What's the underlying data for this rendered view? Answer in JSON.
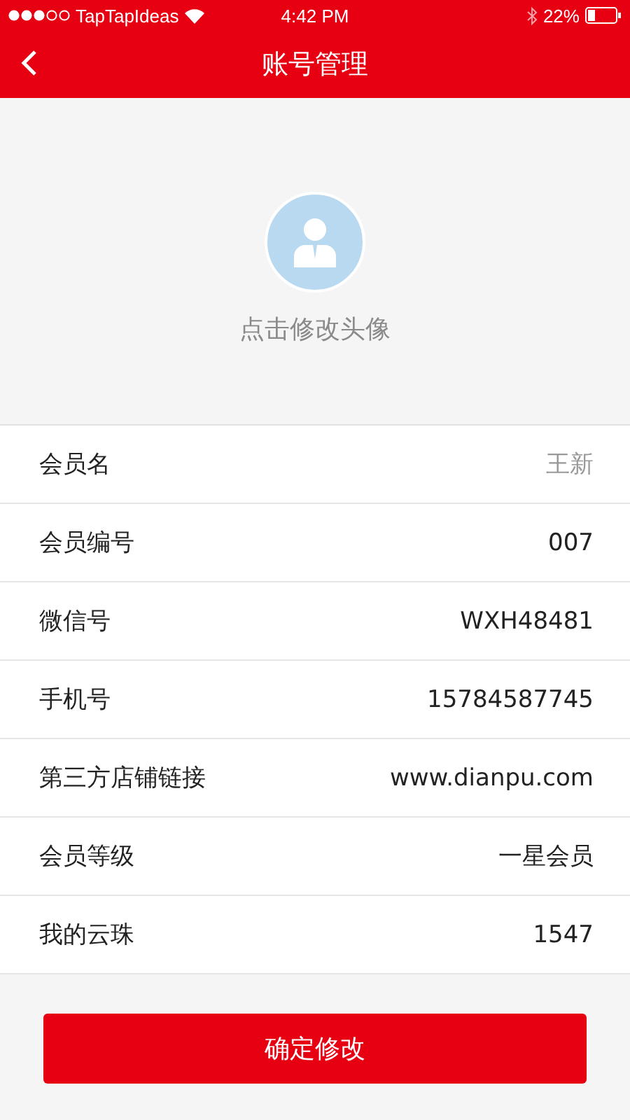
{
  "status_bar": {
    "carrier": "TapTapIdeas",
    "time": "4:42 PM",
    "battery": "22%"
  },
  "nav": {
    "title": "账号管理"
  },
  "avatar": {
    "caption": "点击修改头像"
  },
  "rows": [
    {
      "label": "会员名",
      "value": "王新",
      "disabled": true
    },
    {
      "label": "会员编号",
      "value": "007",
      "disabled": false
    },
    {
      "label": "微信号",
      "value": "WXH48481",
      "disabled": false
    },
    {
      "label": "手机号",
      "value": "15784587745",
      "disabled": false
    },
    {
      "label": "第三方店铺链接",
      "value": "www.dianpu.com",
      "disabled": false
    },
    {
      "label": "会员等级",
      "value": "一星会员",
      "disabled": false
    },
    {
      "label": "我的云珠",
      "value": "1547",
      "disabled": false
    }
  ],
  "confirm_button": "确定修改"
}
